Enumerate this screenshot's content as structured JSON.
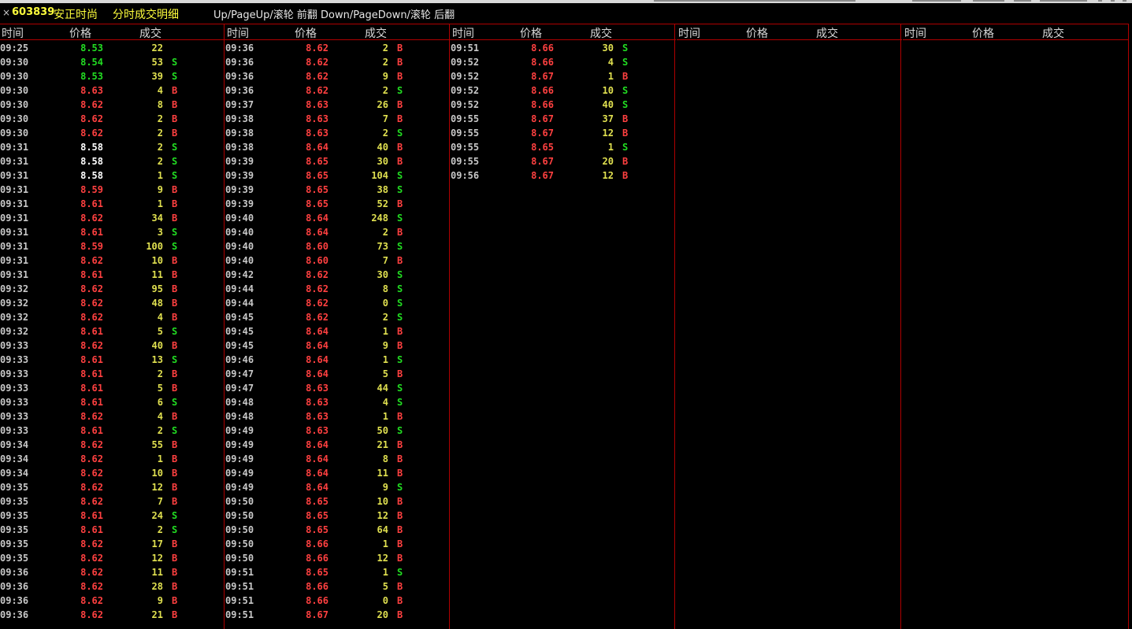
{
  "title": {
    "close": "×",
    "code": "603839",
    "name": "安正时尚",
    "panel": "分时成交明细",
    "hint": "Up/PageUp/滚轮 前翻 Down/PageDown/滚轮 后翻"
  },
  "headers": {
    "time": "时间",
    "price": "价格",
    "volume": "成交"
  },
  "colors": {
    "up": "#ff4040",
    "down": "#22dd22",
    "flat": "#ffffff",
    "volume": "#e0e050",
    "grid": "#b00000"
  },
  "columns": [
    [
      [
        "09:25",
        "8.53",
        "22",
        "",
        "dn"
      ],
      [
        "09:30",
        "8.54",
        "53",
        "S",
        "dn"
      ],
      [
        "09:30",
        "8.53",
        "39",
        "S",
        "dn"
      ],
      [
        "09:30",
        "8.63",
        "4",
        "B",
        "up"
      ],
      [
        "09:30",
        "8.62",
        "8",
        "B",
        "up"
      ],
      [
        "09:30",
        "8.62",
        "2",
        "B",
        "up"
      ],
      [
        "09:30",
        "8.62",
        "2",
        "B",
        "up"
      ],
      [
        "09:31",
        "8.58",
        "2",
        "S",
        "eq"
      ],
      [
        "09:31",
        "8.58",
        "2",
        "S",
        "eq"
      ],
      [
        "09:31",
        "8.58",
        "1",
        "S",
        "eq"
      ],
      [
        "09:31",
        "8.59",
        "9",
        "B",
        "up"
      ],
      [
        "09:31",
        "8.61",
        "1",
        "B",
        "up"
      ],
      [
        "09:31",
        "8.62",
        "34",
        "B",
        "up"
      ],
      [
        "09:31",
        "8.61",
        "3",
        "S",
        "up"
      ],
      [
        "09:31",
        "8.59",
        "100",
        "S",
        "up"
      ],
      [
        "09:31",
        "8.62",
        "10",
        "B",
        "up"
      ],
      [
        "09:31",
        "8.61",
        "11",
        "B",
        "up"
      ],
      [
        "09:32",
        "8.62",
        "95",
        "B",
        "up"
      ],
      [
        "09:32",
        "8.62",
        "48",
        "B",
        "up"
      ],
      [
        "09:32",
        "8.62",
        "4",
        "B",
        "up"
      ],
      [
        "09:32",
        "8.61",
        "5",
        "S",
        "up"
      ],
      [
        "09:33",
        "8.62",
        "40",
        "B",
        "up"
      ],
      [
        "09:33",
        "8.61",
        "13",
        "S",
        "up"
      ],
      [
        "09:33",
        "8.61",
        "2",
        "B",
        "up"
      ],
      [
        "09:33",
        "8.61",
        "5",
        "B",
        "up"
      ],
      [
        "09:33",
        "8.61",
        "6",
        "S",
        "up"
      ],
      [
        "09:33",
        "8.62",
        "4",
        "B",
        "up"
      ],
      [
        "09:33",
        "8.61",
        "2",
        "S",
        "up"
      ],
      [
        "09:34",
        "8.62",
        "55",
        "B",
        "up"
      ],
      [
        "09:34",
        "8.62",
        "1",
        "B",
        "up"
      ],
      [
        "09:34",
        "8.62",
        "10",
        "B",
        "up"
      ],
      [
        "09:35",
        "8.62",
        "12",
        "B",
        "up"
      ],
      [
        "09:35",
        "8.62",
        "7",
        "B",
        "up"
      ],
      [
        "09:35",
        "8.61",
        "24",
        "S",
        "up"
      ],
      [
        "09:35",
        "8.61",
        "2",
        "S",
        "up"
      ],
      [
        "09:35",
        "8.62",
        "17",
        "B",
        "up"
      ],
      [
        "09:35",
        "8.62",
        "12",
        "B",
        "up"
      ],
      [
        "09:36",
        "8.62",
        "11",
        "B",
        "up"
      ],
      [
        "09:36",
        "8.62",
        "28",
        "B",
        "up"
      ],
      [
        "09:36",
        "8.62",
        "9",
        "B",
        "up"
      ],
      [
        "09:36",
        "8.62",
        "21",
        "B",
        "up"
      ]
    ],
    [
      [
        "09:36",
        "8.62",
        "2",
        "B",
        "up"
      ],
      [
        "09:36",
        "8.62",
        "2",
        "B",
        "up"
      ],
      [
        "09:36",
        "8.62",
        "9",
        "B",
        "up"
      ],
      [
        "09:36",
        "8.62",
        "2",
        "S",
        "up"
      ],
      [
        "09:37",
        "8.63",
        "26",
        "B",
        "up"
      ],
      [
        "09:38",
        "8.63",
        "7",
        "B",
        "up"
      ],
      [
        "09:38",
        "8.63",
        "2",
        "S",
        "up"
      ],
      [
        "09:38",
        "8.64",
        "40",
        "B",
        "up"
      ],
      [
        "09:39",
        "8.65",
        "30",
        "B",
        "up"
      ],
      [
        "09:39",
        "8.65",
        "104",
        "S",
        "up"
      ],
      [
        "09:39",
        "8.65",
        "38",
        "S",
        "up"
      ],
      [
        "09:39",
        "8.65",
        "52",
        "B",
        "up"
      ],
      [
        "09:40",
        "8.64",
        "248",
        "S",
        "up"
      ],
      [
        "09:40",
        "8.64",
        "2",
        "B",
        "up"
      ],
      [
        "09:40",
        "8.60",
        "73",
        "S",
        "up"
      ],
      [
        "09:40",
        "8.60",
        "7",
        "B",
        "up"
      ],
      [
        "09:42",
        "8.62",
        "30",
        "S",
        "up"
      ],
      [
        "09:44",
        "8.62",
        "8",
        "S",
        "up"
      ],
      [
        "09:44",
        "8.62",
        "0",
        "S",
        "up"
      ],
      [
        "09:45",
        "8.62",
        "2",
        "S",
        "up"
      ],
      [
        "09:45",
        "8.64",
        "1",
        "B",
        "up"
      ],
      [
        "09:45",
        "8.64",
        "9",
        "B",
        "up"
      ],
      [
        "09:46",
        "8.64",
        "1",
        "S",
        "up"
      ],
      [
        "09:47",
        "8.64",
        "5",
        "B",
        "up"
      ],
      [
        "09:47",
        "8.63",
        "44",
        "S",
        "up"
      ],
      [
        "09:48",
        "8.63",
        "4",
        "S",
        "up"
      ],
      [
        "09:48",
        "8.63",
        "1",
        "B",
        "up"
      ],
      [
        "09:49",
        "8.63",
        "50",
        "S",
        "up"
      ],
      [
        "09:49",
        "8.64",
        "21",
        "B",
        "up"
      ],
      [
        "09:49",
        "8.64",
        "8",
        "B",
        "up"
      ],
      [
        "09:49",
        "8.64",
        "11",
        "B",
        "up"
      ],
      [
        "09:49",
        "8.64",
        "9",
        "S",
        "up"
      ],
      [
        "09:50",
        "8.65",
        "10",
        "B",
        "up"
      ],
      [
        "09:50",
        "8.65",
        "12",
        "B",
        "up"
      ],
      [
        "09:50",
        "8.65",
        "64",
        "B",
        "up"
      ],
      [
        "09:50",
        "8.66",
        "1",
        "B",
        "up"
      ],
      [
        "09:50",
        "8.66",
        "12",
        "B",
        "up"
      ],
      [
        "09:51",
        "8.65",
        "1",
        "S",
        "up"
      ],
      [
        "09:51",
        "8.66",
        "5",
        "B",
        "up"
      ],
      [
        "09:51",
        "8.66",
        "0",
        "B",
        "up"
      ],
      [
        "09:51",
        "8.67",
        "20",
        "B",
        "up"
      ]
    ],
    [
      [
        "09:51",
        "8.66",
        "30",
        "S",
        "up"
      ],
      [
        "09:52",
        "8.66",
        "4",
        "S",
        "up"
      ],
      [
        "09:52",
        "8.67",
        "1",
        "B",
        "up"
      ],
      [
        "09:52",
        "8.66",
        "10",
        "S",
        "up"
      ],
      [
        "09:52",
        "8.66",
        "40",
        "S",
        "up"
      ],
      [
        "09:55",
        "8.67",
        "37",
        "B",
        "up"
      ],
      [
        "09:55",
        "8.67",
        "12",
        "B",
        "up"
      ],
      [
        "09:55",
        "8.65",
        "1",
        "S",
        "up"
      ],
      [
        "09:55",
        "8.67",
        "20",
        "B",
        "up"
      ],
      [
        "09:56",
        "8.67",
        "12",
        "B",
        "up"
      ]
    ],
    [],
    []
  ]
}
